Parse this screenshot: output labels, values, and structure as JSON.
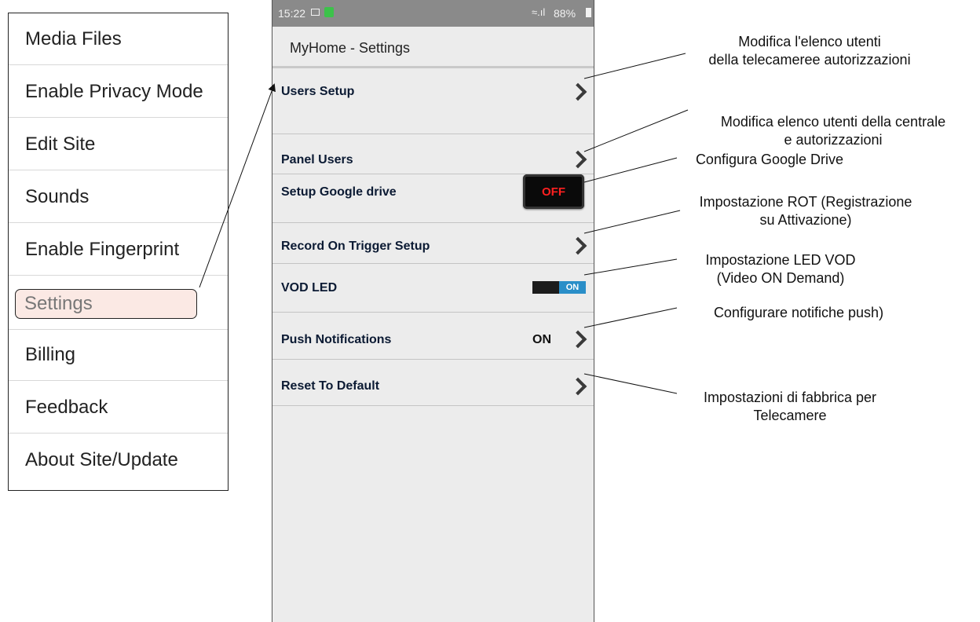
{
  "menu": {
    "items": [
      {
        "label": "Media Files"
      },
      {
        "label": "Enable Privacy Mode"
      },
      {
        "label": "Edit Site"
      },
      {
        "label": "Sounds"
      },
      {
        "label": "Enable Fingerprint"
      },
      {
        "label": "Settings",
        "selected": true
      },
      {
        "label": "Billing"
      },
      {
        "label": "Feedback"
      },
      {
        "label": "About Site/Update"
      }
    ]
  },
  "statusbar": {
    "time": "15:22",
    "battery": "88%",
    "icons": [
      "image-icon",
      "app-notification-icon",
      "wifi-icon",
      "signal-icon",
      "battery-icon"
    ]
  },
  "appbar": {
    "title": "MyHome - Settings"
  },
  "settings": {
    "users_setup": "Users Setup",
    "panel_users": "Panel Users",
    "google_drive": {
      "label": "Setup Google drive",
      "toggle": "OFF"
    },
    "record_on_trigger": "Record On Trigger Setup",
    "vod_led": {
      "label": "VOD LED",
      "toggle": "ON"
    },
    "push_notifications": {
      "label": "Push Notifications",
      "value": "ON"
    },
    "reset_default": "Reset To Default"
  },
  "callouts": {
    "c1": {
      "line1": "Modifica l'elenco utenti",
      "line2": "della telecameree autorizzazioni"
    },
    "c2": {
      "line1": "Modifica elenco utenti della centrale",
      "line2": "e autorizzazioni"
    },
    "c3": {
      "line1": "Configura Google Drive"
    },
    "c4": {
      "line1": "Impostazione ROT (Registrazione",
      "line2": "su Attivazione)"
    },
    "c5": {
      "line1": "Impostazione LED VOD",
      "line2": "(Video ON Demand)"
    },
    "c6": {
      "line1": "Configurare notifiche push)"
    },
    "c7": {
      "line1": "Impostazioni di fabbrica per",
      "line2": "Telecamere"
    }
  },
  "colors": {
    "toggle_off_text": "#ff2020",
    "toggle_on_knob": "#2a8ec8",
    "selected_menu_bg": "#fbe9e4",
    "statusbar_bg": "#8a8a8a"
  }
}
